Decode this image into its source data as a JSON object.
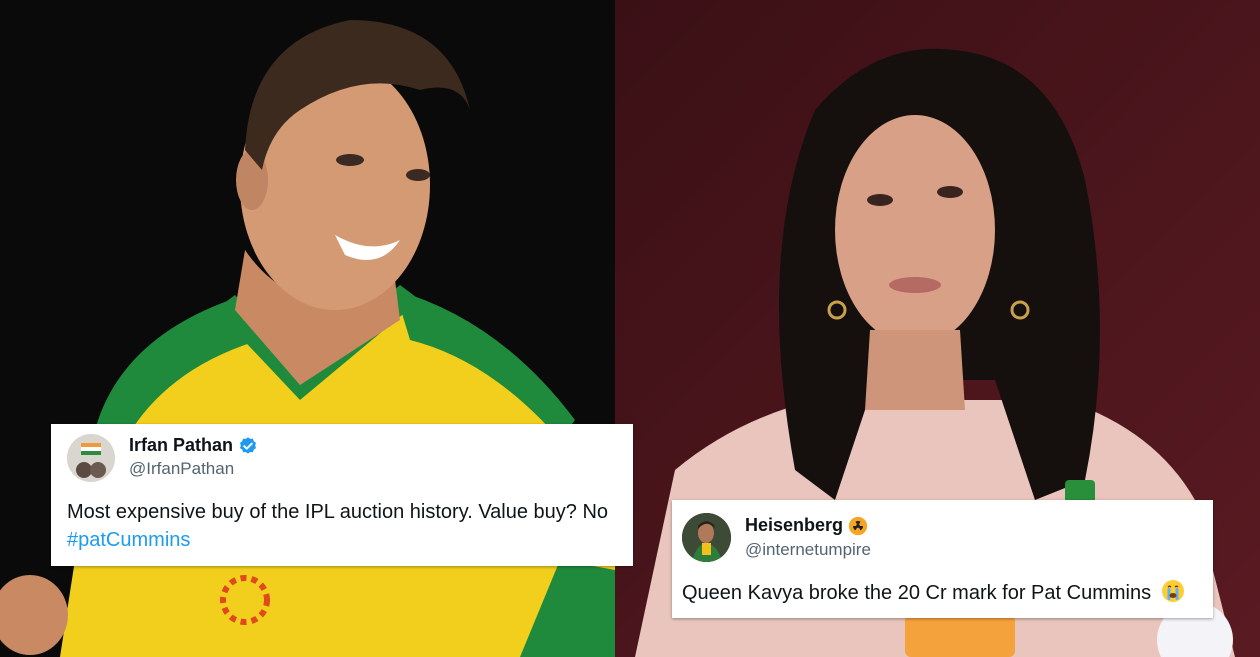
{
  "tweets": [
    {
      "name": "Irfan Pathan",
      "handle": "@IrfanPathan",
      "text": "Most expensive buy of the IPL auction history. Value buy? No",
      "hashtag": "#patCummins",
      "verified": true
    },
    {
      "name": "Heisenberg",
      "handle": "@internetumpire",
      "text": "Queen Kavya broke the 20 Cr mark for Pat Cummins",
      "name_emoji": "radioactive-icon",
      "text_emoji": "crying-face-icon"
    }
  ],
  "colors": {
    "hashtag": "#1d9bf0",
    "verified": "#1d9bf0",
    "jersey_yellow": "#f6d31a",
    "jersey_green": "#1f8a3c"
  }
}
